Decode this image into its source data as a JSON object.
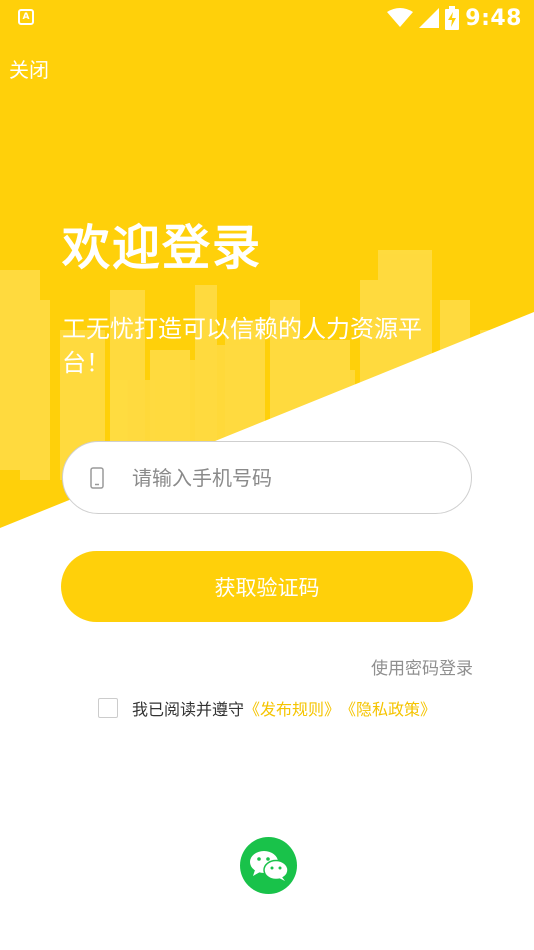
{
  "status_bar": {
    "app_icon": "A",
    "time": "9:48",
    "icons": [
      "wifi-icon",
      "signal-icon",
      "battery-charging-icon"
    ]
  },
  "header": {
    "close_label": "关闭"
  },
  "hero": {
    "title": "欢迎登录",
    "subtitle": "工无忧打造可以信赖的人力资源平台！"
  },
  "form": {
    "phone_placeholder": "请输入手机号码",
    "phone_value": "",
    "phone_icon": "phone-icon",
    "get_code_label": "获取验证码",
    "password_login_label": "使用密码登录"
  },
  "agreement": {
    "checked": false,
    "prefix": "我已阅读并遵守",
    "rules_link": "《发布规则》",
    "privacy_link": "《隐私政策》"
  },
  "social": {
    "wechat_icon": "wechat-icon"
  },
  "colors": {
    "brand": "#ffd00a",
    "link": "#f5c400",
    "wechat": "#19c24a"
  }
}
